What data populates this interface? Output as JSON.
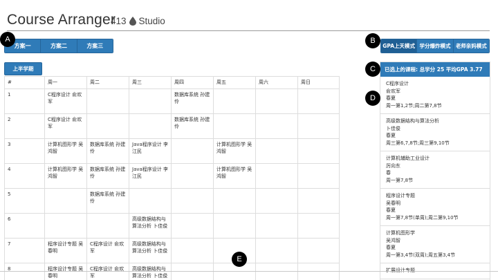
{
  "header": {
    "title": "Course Arranger",
    "subtitle_num": "413",
    "subtitle_text": "Studio"
  },
  "plans": [
    "方案一",
    "方案二",
    "方案三"
  ],
  "modes": [
    "GPA上天模式",
    "学分爆炸模式",
    "老师亲妈模式"
  ],
  "term_label": "上半学期",
  "markers": [
    "A",
    "B",
    "C",
    "D",
    "E"
  ],
  "schedule": {
    "headers": [
      "#",
      "周一",
      "周二",
      "周三",
      "周四",
      "周五",
      "周六",
      "周日"
    ],
    "rows": [
      [
        "1",
        "C程序设计 俞欢军",
        "",
        "",
        "数据库系统 孙建伶",
        "",
        "",
        ""
      ],
      [
        "2",
        "C程序设计 俞欢军",
        "",
        "",
        "数据库系统 孙建伶",
        "",
        "",
        ""
      ],
      [
        "3",
        "计算机图形学 吴鸿智",
        "数据库系统 孙建伶",
        "Java程序设计 李江民",
        "",
        "计算机图形学 吴鸿智",
        "",
        ""
      ],
      [
        "4",
        "计算机图形学 吴鸿智",
        "数据库系统 孙建伶",
        "Java程序设计 李江民",
        "",
        "计算机图形学 吴鸿智",
        "",
        ""
      ],
      [
        "5",
        "",
        "数据库系统 孙建伶",
        "",
        "",
        "",
        "",
        ""
      ],
      [
        "6",
        "",
        "",
        "高级数据结构与算法分析 卜佳俊",
        "",
        "",
        "",
        ""
      ],
      [
        "7",
        "程序设计专题 吴春明",
        "C程序设计 俞欢军",
        "高级数据结构与算法分析 卜佳俊",
        "",
        "",
        "",
        ""
      ],
      [
        "8",
        "程序设计专题 吴春明",
        "C程序设计 俞欢军",
        "高级数据结构与算法分析 卜佳俊",
        "",
        "",
        "",
        ""
      ]
    ]
  },
  "selected": {
    "header": "已选上的课程: 总学分 25 平均GPA 3.77",
    "courses": [
      {
        "name": "C程序设计",
        "teacher": "俞欢军",
        "term": "春夏",
        "time": "周一第1,2节;周二第7,8节"
      },
      {
        "name": "高级数据结构与算法分析",
        "teacher": "卜佳俊",
        "term": "春夏",
        "time": "周三第6,7,8节;周三第9,10节"
      },
      {
        "name": "计算机辅助工业设计",
        "teacher": "厉向东",
        "term": "春",
        "time": "周一第7,8节"
      },
      {
        "name": "程序设计专题",
        "teacher": "吴春明",
        "term": "春夏",
        "time": "周一第7,8节(单周);周二第9,10节"
      },
      {
        "name": "计算机图形学",
        "teacher": "吴鸿智",
        "term": "春夏",
        "time": "周一第3,4节(双周);周五第3,4节"
      },
      {
        "name": "扩展设计专题",
        "teacher": "",
        "term": "",
        "time": ""
      }
    ]
  }
}
